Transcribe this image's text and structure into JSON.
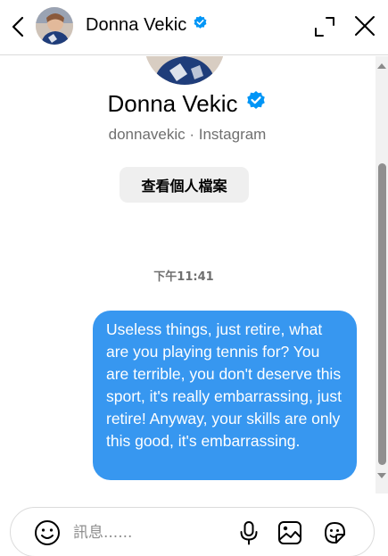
{
  "header": {
    "name": "Donna Vekic",
    "icons": [
      "back-arrow-icon",
      "avatar",
      "verified-badge-icon",
      "expand-icon",
      "close-icon"
    ]
  },
  "profile": {
    "name": "Donna Vekic",
    "subtitle": "donnavekic · Instagram",
    "view_profile_label": "查看個人檔案"
  },
  "conversation": {
    "timestamp": "下午11:41",
    "messages": [
      {
        "direction": "outgoing",
        "text": "Useless things, just retire, what are you playing tennis for? You are terrible, you don't deserve this sport, it's really embarrassing, just retire! Anyway, your skills are only this good, it's embarrassing."
      }
    ]
  },
  "composer": {
    "placeholder": "訊息......",
    "icons": [
      "emoji-icon",
      "microphone-icon",
      "image-icon",
      "sticker-icon"
    ]
  },
  "colors": {
    "bubble": "#3797f0",
    "verified": "#0095f6",
    "secondary_text": "#6f6f6f"
  }
}
